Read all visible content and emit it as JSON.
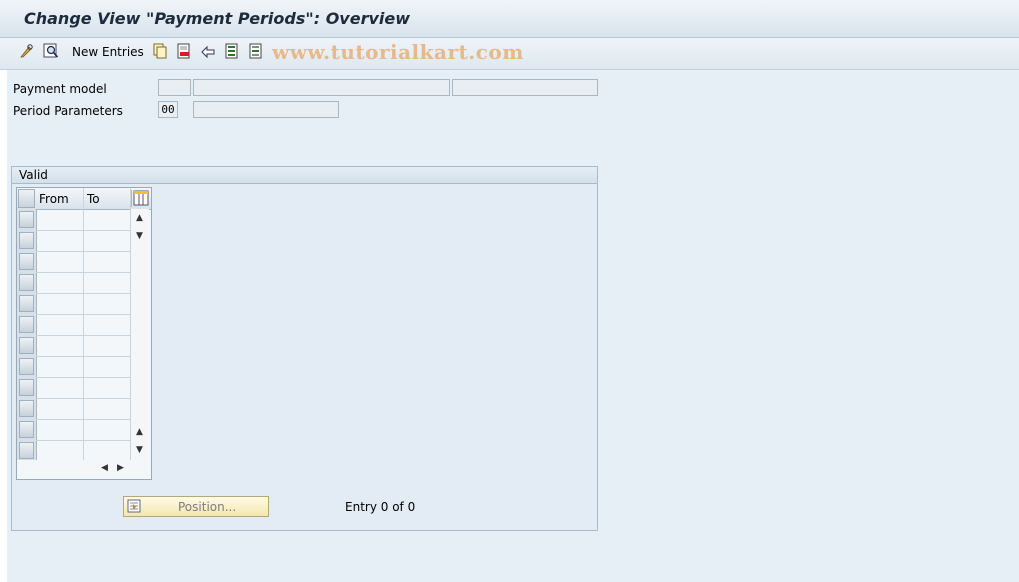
{
  "window": {
    "title": "Change View \"Payment Periods\": Overview"
  },
  "toolbar": {
    "icons": [
      "edit-glasses-icon",
      "find-icon",
      "copy-icon",
      "delete-icon",
      "undo-icon",
      "select-all-icon",
      "deselect-all-icon"
    ],
    "new_entries_label": "New Entries",
    "watermark": "www.tutorialkart.com"
  },
  "header": {
    "payment_model_label": "Payment model",
    "payment_model_value": "",
    "payment_model_text": "",
    "payment_model_text2": "",
    "period_parameters_label": "Period Parameters",
    "period_parameters_value": "00",
    "period_parameters_text": ""
  },
  "valid_group": {
    "title": "Valid",
    "columns": [
      "From",
      "To"
    ],
    "rows": [],
    "visible_row_count": 12
  },
  "footer": {
    "position_button_label": "Position...",
    "entry_text": "Entry 0 of 0"
  }
}
